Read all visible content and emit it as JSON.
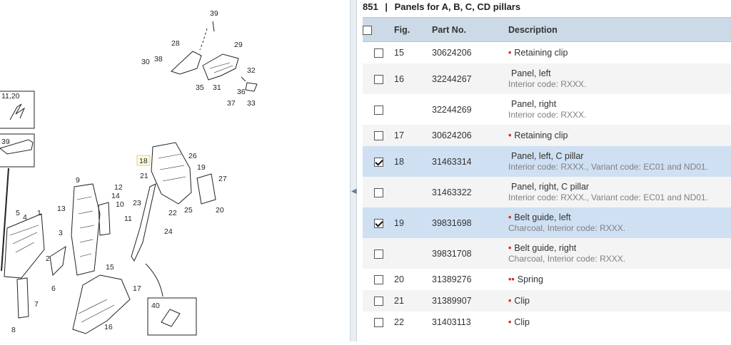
{
  "diagram": {
    "callouts": [
      "5",
      "4",
      "1",
      "3",
      "2",
      "6",
      "7",
      "8",
      "9",
      "13",
      "12",
      "14",
      "10",
      "11",
      "15",
      "17",
      "16",
      "18",
      "21",
      "26",
      "19",
      "27",
      "23",
      "22",
      "25",
      "20",
      "24",
      "28",
      "29",
      "30",
      "38",
      "32",
      "35",
      "31",
      "36",
      "37",
      "33",
      "11,20",
      "39",
      "40"
    ]
  },
  "panel": {
    "section_number": "851",
    "separator": "|",
    "section_title": "Panels for A, B, C, CD pillars"
  },
  "table": {
    "headers": {
      "fig": "Fig.",
      "part": "Part No.",
      "description": "Description"
    },
    "rows": [
      {
        "checked": false,
        "fig": "15",
        "part": "30624206",
        "bullet": "•",
        "desc": "Retaining clip",
        "sub": ""
      },
      {
        "checked": false,
        "fig": "16",
        "part": "32244267",
        "bullet": "",
        "desc": "Panel, left",
        "sub": "Interior code: RXXX."
      },
      {
        "checked": false,
        "fig": "",
        "part": "32244269",
        "bullet": "",
        "desc": "Panel, right",
        "sub": "Interior code: RXXX."
      },
      {
        "checked": false,
        "fig": "17",
        "part": "30624206",
        "bullet": "•",
        "desc": "Retaining clip",
        "sub": ""
      },
      {
        "checked": true,
        "fig": "18",
        "part": "31463314",
        "bullet": "",
        "desc": "Panel, left, C pillar",
        "sub": "Interior code: RXXX., Variant code: EC01 and ND01."
      },
      {
        "checked": false,
        "fig": "",
        "part": "31463322",
        "bullet": "",
        "desc": "Panel, right, C pillar",
        "sub": "Interior code: RXXX., Variant code: EC01 and ND01."
      },
      {
        "checked": true,
        "fig": "19",
        "part": "39831698",
        "bullet": "•",
        "desc": "Belt guide, left",
        "sub": "Charcoal, Interior code: RXXX."
      },
      {
        "checked": false,
        "fig": "",
        "part": "39831708",
        "bullet": "•",
        "desc": "Belt guide, right",
        "sub": "Charcoal, Interior code: RXXX."
      },
      {
        "checked": false,
        "fig": "20",
        "part": "31389276",
        "bullet": "••",
        "desc": "Spring",
        "sub": ""
      },
      {
        "checked": false,
        "fig": "21",
        "part": "31389907",
        "bullet": "•",
        "desc": "Clip",
        "sub": ""
      },
      {
        "checked": false,
        "fig": "22",
        "part": "31403113",
        "bullet": "•",
        "desc": "Clip",
        "sub": ""
      }
    ]
  },
  "colors": {
    "header_bg": "#ccd9e6",
    "selected_row": "#cfe0f3",
    "alt_row": "#f4f4f4",
    "bullet": "#d62c2c"
  }
}
